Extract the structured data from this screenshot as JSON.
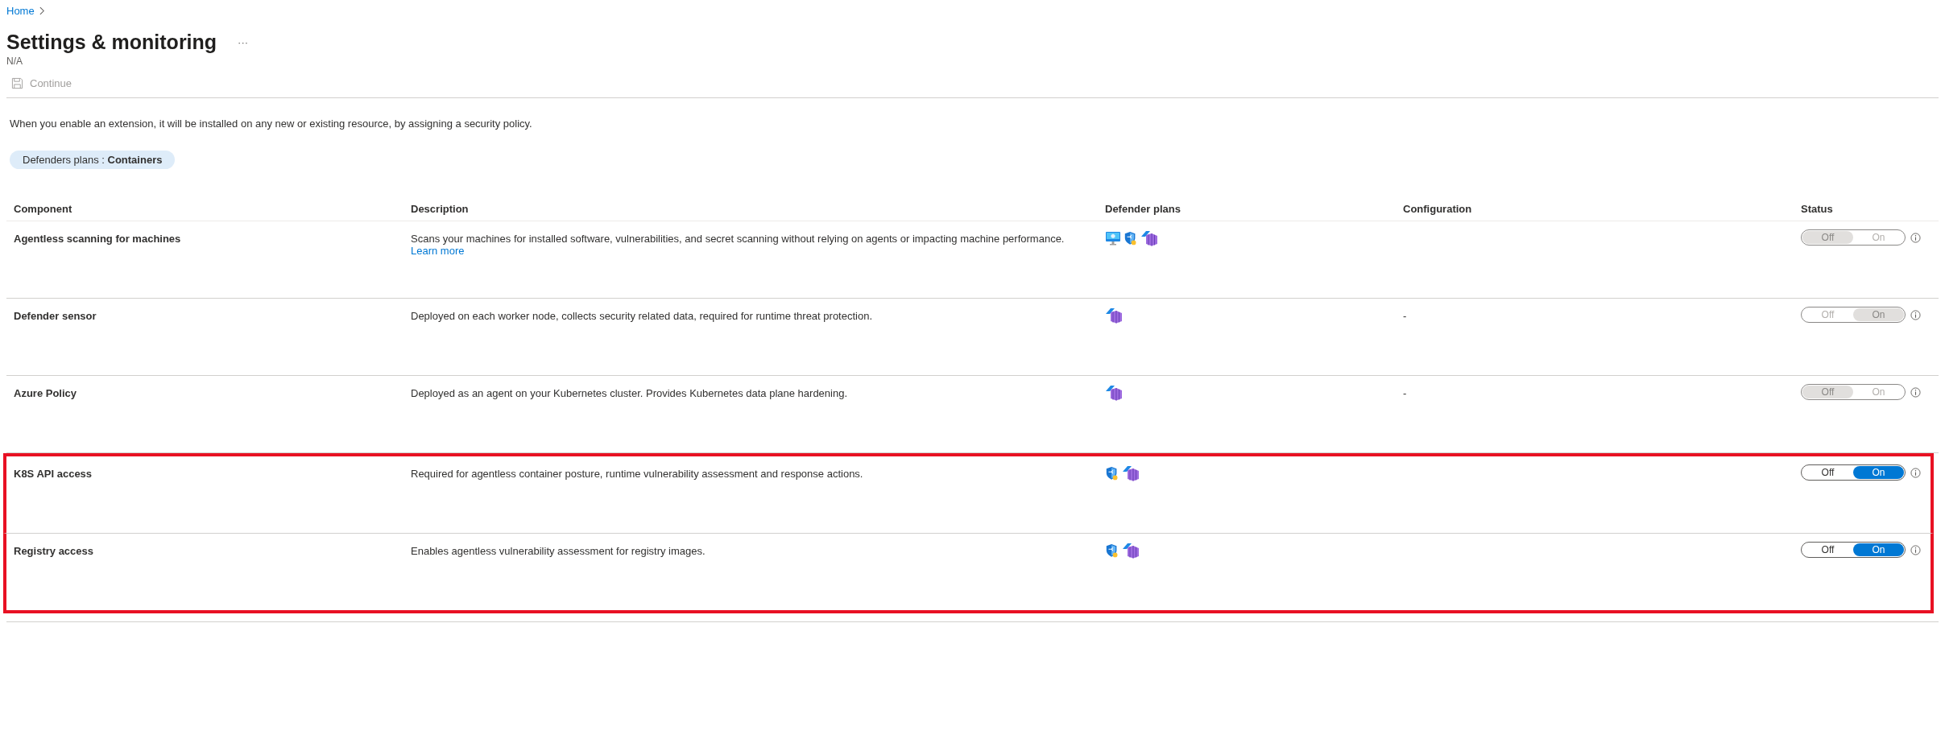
{
  "breadcrumb": [
    {
      "label": "Home"
    }
  ],
  "title": "Settings & monitoring",
  "more": "···",
  "subtitle": "N/A",
  "toolbar": [
    {
      "label": "Continue",
      "disabled": true
    }
  ],
  "info": "When you enable an extension, it will be installed on any new or existing resource, by assigning a security policy.",
  "filter_pill": "Defenders plans : **Containers**",
  "table": {
    "columns": [
      "Component",
      "Description",
      "Defender plans",
      "Configuration",
      "Status"
    ],
    "rows": [
      {
        "component": "Agentless scanning for machines",
        "description": "Scans your machines for installed software, vulnerabilities, and secret scanning without relying on agents or impacting machine performance.",
        "link": "Learn more",
        "plans": [
          {
            "kind": "monitor"
          },
          {
            "kind": "shield"
          },
          {
            "kind": "container"
          }
        ],
        "status": {
          "off": "Off",
          "on": "On",
          "selected_on": false,
          "disabled": true
        },
        "highlighted": false
      },
      {
        "component": "Defender sensor",
        "description": "Deployed on each worker node, collects security related data, required for runtime threat protection.",
        "plans": [
          {
            "kind": "container"
          }
        ],
        "configuration": "-",
        "status": {
          "off": "Off",
          "on": "On",
          "selected_on": true,
          "disabled": true
        },
        "highlighted": false
      },
      {
        "component": "Azure Policy",
        "description": "Deployed as an agent on your Kubernetes cluster. Provides Kubernetes data plane hardening.",
        "plans": [
          {
            "kind": "container"
          }
        ],
        "configuration": "-",
        "status": {
          "off": "Off",
          "on": "On",
          "selected_on": false,
          "disabled": true
        },
        "highlighted": false
      },
      {
        "component": "K8S API access",
        "description": "Required for agentless container posture, runtime vulnerability assessment and response actions.",
        "plans": [
          {
            "kind": "shield"
          },
          {
            "kind": "container"
          }
        ],
        "status": {
          "off": "Off",
          "on": "On",
          "selected_on": true,
          "disabled": false
        },
        "highlighted": true
      },
      {
        "component": "Registry access",
        "description": "Enables agentless vulnerability assessment for registry images.",
        "plans": [
          {
            "kind": "shield"
          },
          {
            "kind": "container"
          }
        ],
        "status": {
          "off": "Off",
          "on": "On",
          "selected_on": true,
          "disabled": false
        },
        "highlighted": true
      }
    ]
  }
}
